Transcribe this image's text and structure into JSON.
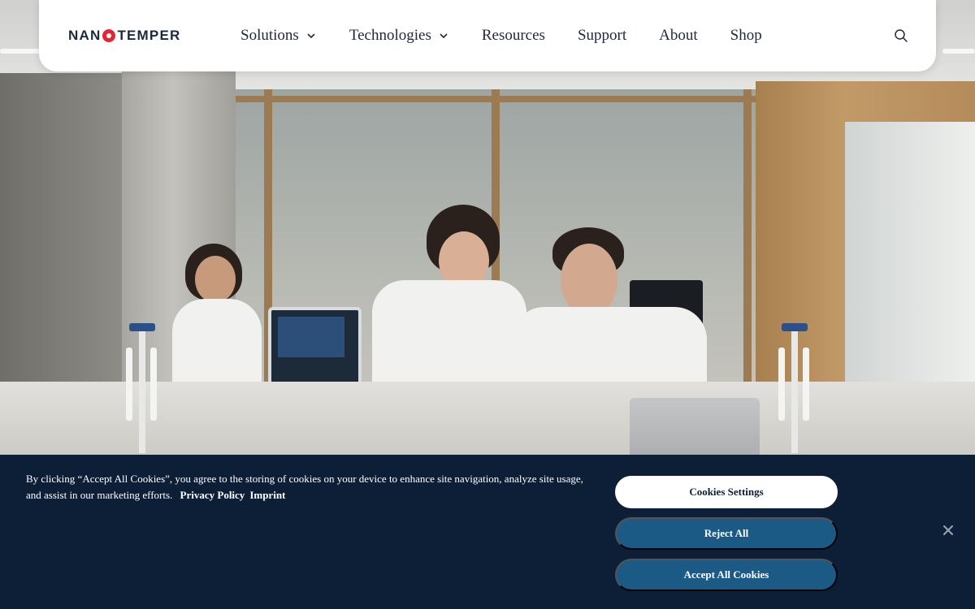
{
  "nav": {
    "logo_text_left": "NAN",
    "logo_text_right": "TEMPER",
    "items": [
      {
        "label": "Solutions",
        "has_dropdown": true
      },
      {
        "label": "Technologies",
        "has_dropdown": true
      },
      {
        "label": "Resources",
        "has_dropdown": false
      },
      {
        "label": "Support",
        "has_dropdown": false
      },
      {
        "label": "About",
        "has_dropdown": false
      },
      {
        "label": "Shop",
        "has_dropdown": false
      }
    ],
    "search_icon": "search-icon"
  },
  "hero": {
    "image_subject": "lab-scientists-photo"
  },
  "cookie_banner": {
    "message": "By clicking “Accept All Cookies”, you agree to the storing of cookies on your device to enhance site navigation, analyze site usage, and assist in our marketing efforts.",
    "privacy_link": "Privacy Policy",
    "imprint_link": "Imprint",
    "settings_button": "Cookies Settings",
    "reject_button": "Reject All",
    "accept_button": "Accept All Cookies",
    "close_icon": "close-icon"
  },
  "colors": {
    "brand_red": "#e22633",
    "brand_navy": "#1a2a3c",
    "banner_bg": "#0c1f36",
    "button_blue": "#1b5a85"
  }
}
